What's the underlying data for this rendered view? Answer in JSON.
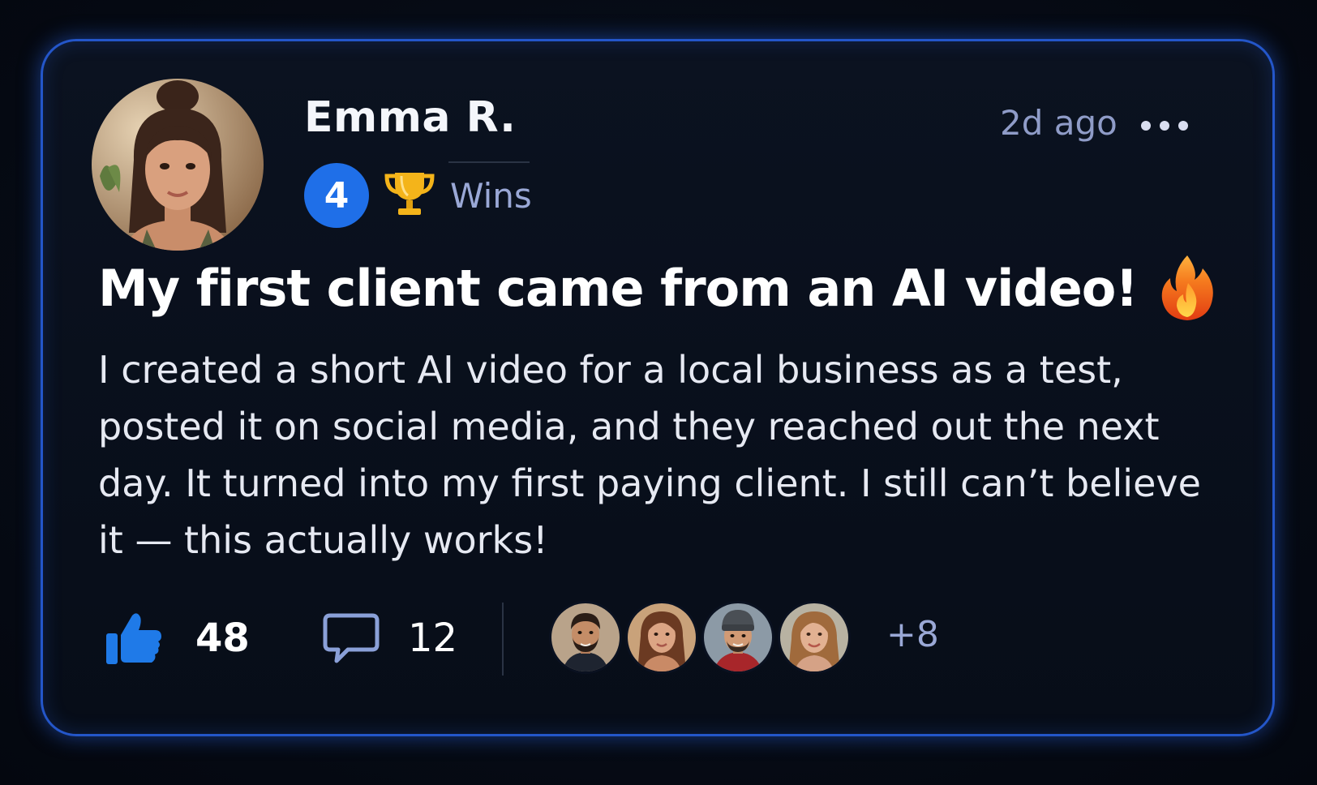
{
  "post": {
    "author": {
      "name": "Emma R.",
      "level": "4",
      "wins_label": "Wins",
      "avatar_icon": "woman-portrait"
    },
    "time": "2d ago",
    "more_icon": "more-horizontal-icon",
    "title": "My first client came from an AI video!",
    "title_emoji_icon": "fire-icon",
    "body": "I created a short AI video for a local business as a test, posted it on social media, and they reached out the next day. It turned into my first paying client. I still can’t believe it — this actually works!",
    "likes": "48",
    "comments": "12",
    "reactors_more": "+8",
    "colors": {
      "accent": "#1f6fe8",
      "border": "#2456c9",
      "background": "#070d18",
      "muted_text": "#9aa8d6"
    }
  }
}
